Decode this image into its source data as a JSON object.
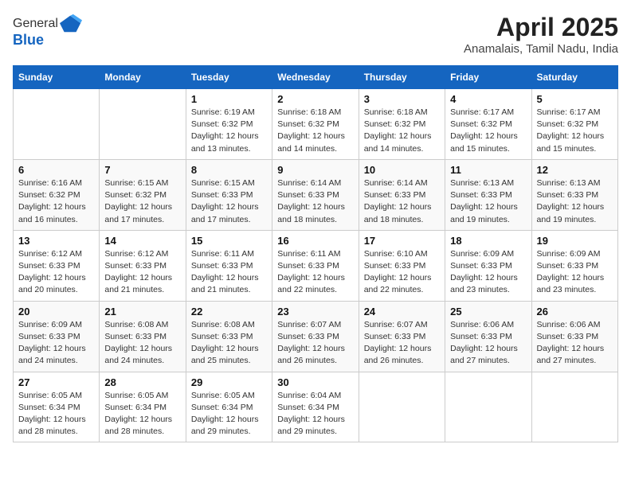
{
  "logo": {
    "general": "General",
    "blue": "Blue"
  },
  "header": {
    "title": "April 2025",
    "subtitle": "Anamalais, Tamil Nadu, India"
  },
  "days_of_week": [
    "Sunday",
    "Monday",
    "Tuesday",
    "Wednesday",
    "Thursday",
    "Friday",
    "Saturday"
  ],
  "weeks": [
    [
      {
        "day": "",
        "info": ""
      },
      {
        "day": "",
        "info": ""
      },
      {
        "day": "1",
        "info": "Sunrise: 6:19 AM\nSunset: 6:32 PM\nDaylight: 12 hours and 13 minutes."
      },
      {
        "day": "2",
        "info": "Sunrise: 6:18 AM\nSunset: 6:32 PM\nDaylight: 12 hours and 14 minutes."
      },
      {
        "day": "3",
        "info": "Sunrise: 6:18 AM\nSunset: 6:32 PM\nDaylight: 12 hours and 14 minutes."
      },
      {
        "day": "4",
        "info": "Sunrise: 6:17 AM\nSunset: 6:32 PM\nDaylight: 12 hours and 15 minutes."
      },
      {
        "day": "5",
        "info": "Sunrise: 6:17 AM\nSunset: 6:32 PM\nDaylight: 12 hours and 15 minutes."
      }
    ],
    [
      {
        "day": "6",
        "info": "Sunrise: 6:16 AM\nSunset: 6:32 PM\nDaylight: 12 hours and 16 minutes."
      },
      {
        "day": "7",
        "info": "Sunrise: 6:15 AM\nSunset: 6:32 PM\nDaylight: 12 hours and 17 minutes."
      },
      {
        "day": "8",
        "info": "Sunrise: 6:15 AM\nSunset: 6:33 PM\nDaylight: 12 hours and 17 minutes."
      },
      {
        "day": "9",
        "info": "Sunrise: 6:14 AM\nSunset: 6:33 PM\nDaylight: 12 hours and 18 minutes."
      },
      {
        "day": "10",
        "info": "Sunrise: 6:14 AM\nSunset: 6:33 PM\nDaylight: 12 hours and 18 minutes."
      },
      {
        "day": "11",
        "info": "Sunrise: 6:13 AM\nSunset: 6:33 PM\nDaylight: 12 hours and 19 minutes."
      },
      {
        "day": "12",
        "info": "Sunrise: 6:13 AM\nSunset: 6:33 PM\nDaylight: 12 hours and 19 minutes."
      }
    ],
    [
      {
        "day": "13",
        "info": "Sunrise: 6:12 AM\nSunset: 6:33 PM\nDaylight: 12 hours and 20 minutes."
      },
      {
        "day": "14",
        "info": "Sunrise: 6:12 AM\nSunset: 6:33 PM\nDaylight: 12 hours and 21 minutes."
      },
      {
        "day": "15",
        "info": "Sunrise: 6:11 AM\nSunset: 6:33 PM\nDaylight: 12 hours and 21 minutes."
      },
      {
        "day": "16",
        "info": "Sunrise: 6:11 AM\nSunset: 6:33 PM\nDaylight: 12 hours and 22 minutes."
      },
      {
        "day": "17",
        "info": "Sunrise: 6:10 AM\nSunset: 6:33 PM\nDaylight: 12 hours and 22 minutes."
      },
      {
        "day": "18",
        "info": "Sunrise: 6:09 AM\nSunset: 6:33 PM\nDaylight: 12 hours and 23 minutes."
      },
      {
        "day": "19",
        "info": "Sunrise: 6:09 AM\nSunset: 6:33 PM\nDaylight: 12 hours and 23 minutes."
      }
    ],
    [
      {
        "day": "20",
        "info": "Sunrise: 6:09 AM\nSunset: 6:33 PM\nDaylight: 12 hours and 24 minutes."
      },
      {
        "day": "21",
        "info": "Sunrise: 6:08 AM\nSunset: 6:33 PM\nDaylight: 12 hours and 24 minutes."
      },
      {
        "day": "22",
        "info": "Sunrise: 6:08 AM\nSunset: 6:33 PM\nDaylight: 12 hours and 25 minutes."
      },
      {
        "day": "23",
        "info": "Sunrise: 6:07 AM\nSunset: 6:33 PM\nDaylight: 12 hours and 26 minutes."
      },
      {
        "day": "24",
        "info": "Sunrise: 6:07 AM\nSunset: 6:33 PM\nDaylight: 12 hours and 26 minutes."
      },
      {
        "day": "25",
        "info": "Sunrise: 6:06 AM\nSunset: 6:33 PM\nDaylight: 12 hours and 27 minutes."
      },
      {
        "day": "26",
        "info": "Sunrise: 6:06 AM\nSunset: 6:33 PM\nDaylight: 12 hours and 27 minutes."
      }
    ],
    [
      {
        "day": "27",
        "info": "Sunrise: 6:05 AM\nSunset: 6:34 PM\nDaylight: 12 hours and 28 minutes."
      },
      {
        "day": "28",
        "info": "Sunrise: 6:05 AM\nSunset: 6:34 PM\nDaylight: 12 hours and 28 minutes."
      },
      {
        "day": "29",
        "info": "Sunrise: 6:05 AM\nSunset: 6:34 PM\nDaylight: 12 hours and 29 minutes."
      },
      {
        "day": "30",
        "info": "Sunrise: 6:04 AM\nSunset: 6:34 PM\nDaylight: 12 hours and 29 minutes."
      },
      {
        "day": "",
        "info": ""
      },
      {
        "day": "",
        "info": ""
      },
      {
        "day": "",
        "info": ""
      }
    ]
  ]
}
